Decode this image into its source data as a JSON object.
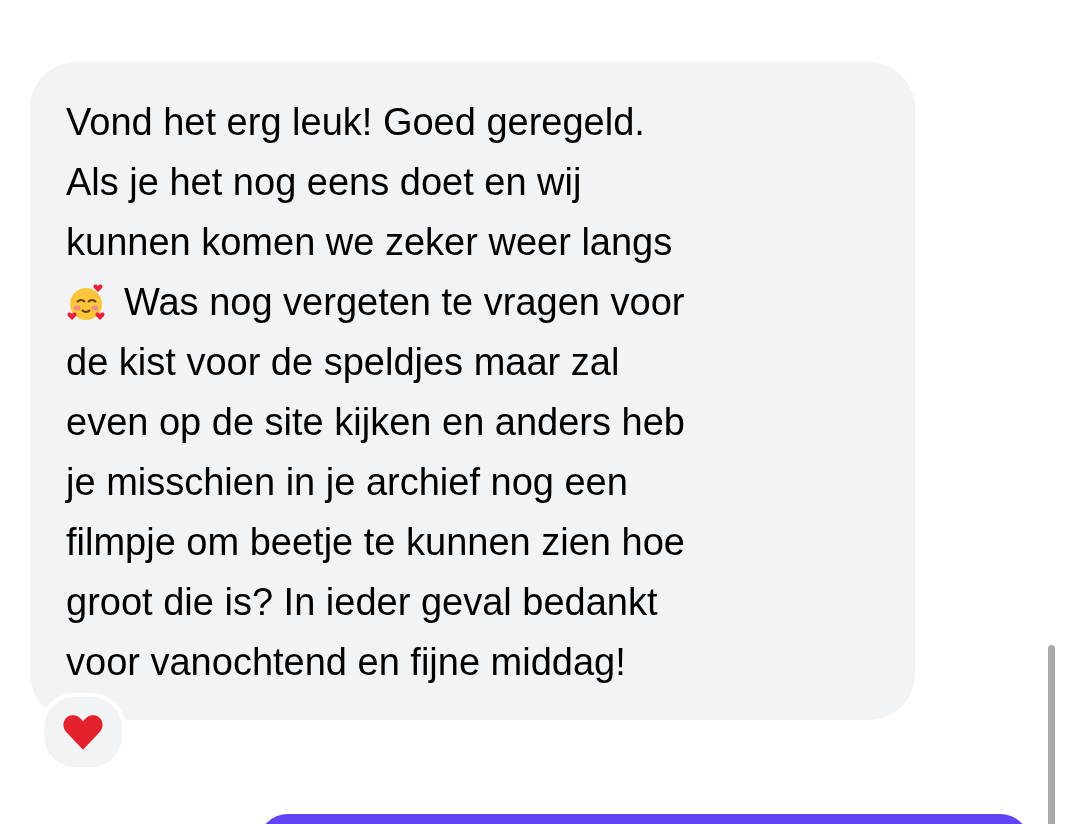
{
  "message": {
    "lines": [
      {
        "kind": "text",
        "text": "Vond het erg leuk! Goed geregeld."
      },
      {
        "kind": "text",
        "text": "Als je het nog eens doet en wij"
      },
      {
        "kind": "text",
        "text": "kunnen komen we zeker weer langs"
      },
      {
        "kind": "emoji_text",
        "text": "Was nog vergeten te vragen voor"
      },
      {
        "kind": "text",
        "text": "de kist voor de speldjes maar zal"
      },
      {
        "kind": "text",
        "text": "even op de site kijken en anders heb"
      },
      {
        "kind": "text",
        "text": "je misschien in je archief nog een"
      },
      {
        "kind": "text",
        "text": "filmpje om beetje te kunnen zien hoe"
      },
      {
        "kind": "text",
        "text": "groot die is? In ieder geval bedankt"
      },
      {
        "kind": "text",
        "text": "voor vanochtend en fijne middag!"
      }
    ],
    "reaction": {
      "kind": "heart"
    }
  }
}
